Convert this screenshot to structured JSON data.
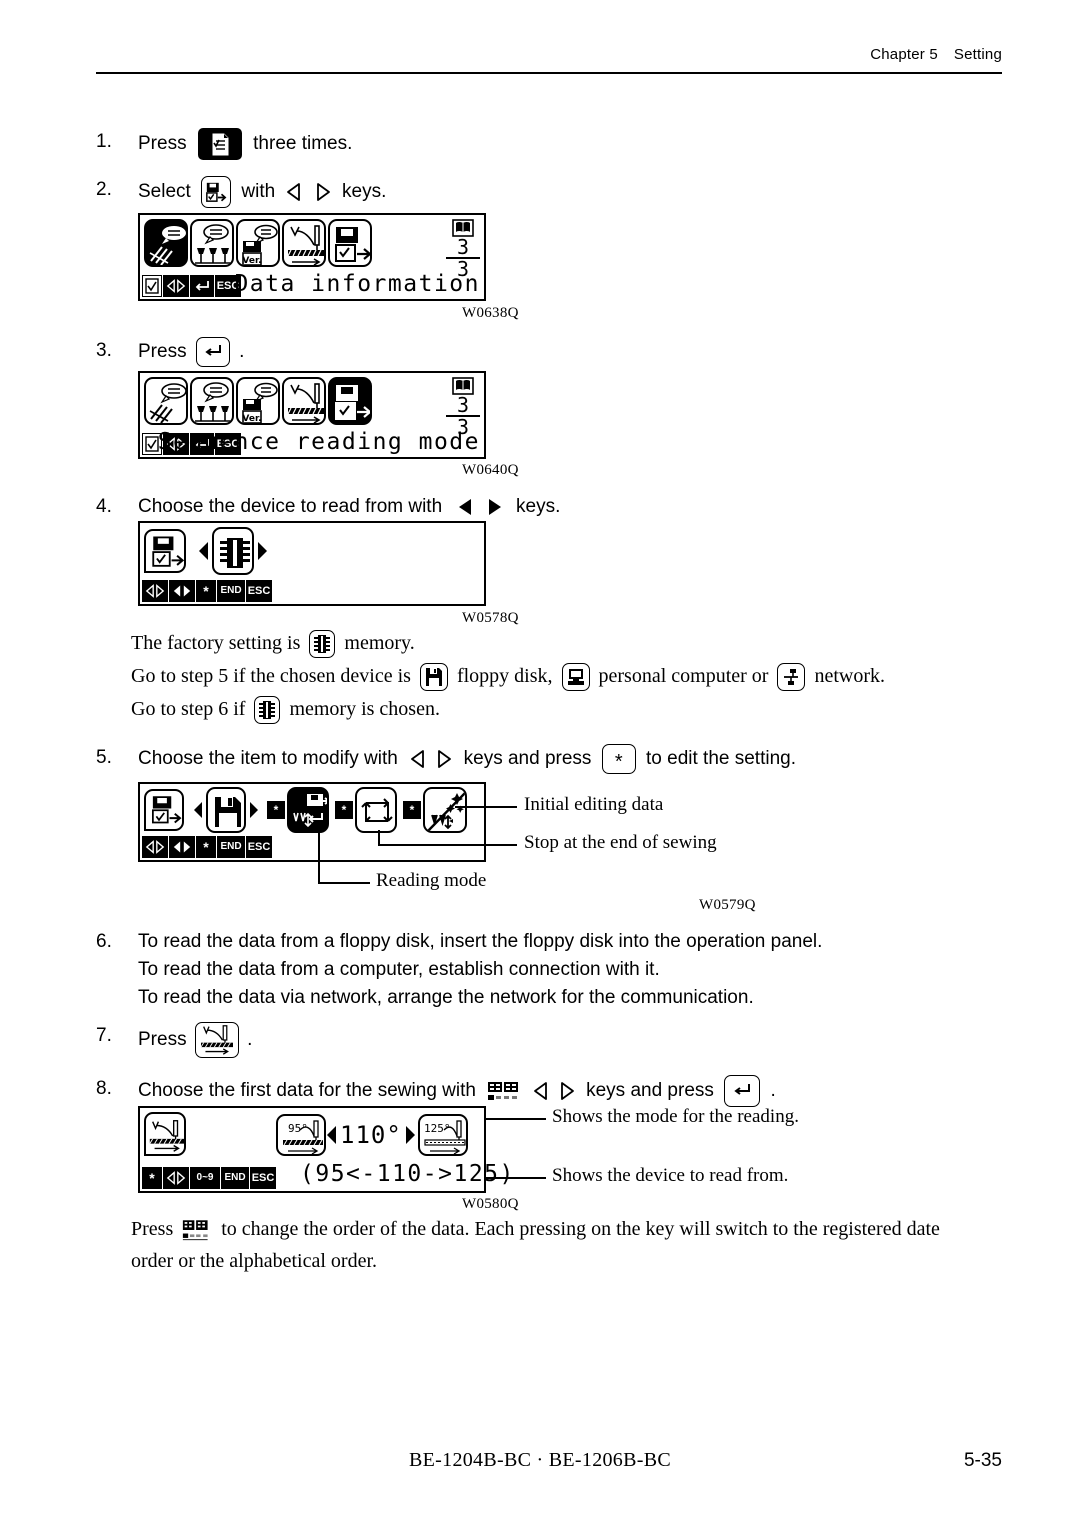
{
  "header": {
    "chapter": "Chapter 5",
    "section": "Setting"
  },
  "steps": [
    {
      "num": "1.",
      "lead": "Press",
      "tail": "three times.",
      "icon": "document-check-key"
    },
    {
      "num": "2.",
      "lead": "Select",
      "mid": "with",
      "tail": "keys.",
      "icon": "data-information-key"
    },
    {
      "num": "3.",
      "lead": "Press",
      "tail": ".",
      "icon": "enter-key"
    },
    {
      "num": "4.",
      "lead": "Choose the device to read from with",
      "tail": "keys."
    },
    {
      "num": "5.",
      "lead": "Choose the item to modify with",
      "mid": "keys and press",
      "tail": "to edit the setting.",
      "star": "*"
    },
    {
      "num": "6.",
      "lines": [
        "To read the data from a floppy disk, insert the floppy disk into the operation panel.",
        "To read the data from a computer, establish connection with it.",
        "To read the data via network, arrange the network for the communication."
      ]
    },
    {
      "num": "7.",
      "lead": "Press",
      "tail": "."
    },
    {
      "num": "8.",
      "lead": "Choose the first data for the sewing with",
      "mid": "keys and press",
      "tail": "."
    }
  ],
  "lcd1": {
    "message": "Data information",
    "page_current": "3",
    "page_total": "3",
    "selected_index": 0,
    "tiles": [
      "sewing-speech-icon",
      "tension-speech-icon",
      "version-speech-icon",
      "sewing-pattern-icon",
      "data-information-icon"
    ],
    "softkeys": [
      "check-icon",
      "left-right-arrows-icon",
      "enter-icon",
      "ESC"
    ],
    "caption": "W0638Q"
  },
  "lcd2": {
    "message": "Sequence reading mode",
    "page_current": "3",
    "page_total": "3",
    "selected_index": 4,
    "tiles": [
      "sewing-speech-icon",
      "tension-speech-icon",
      "version-speech-icon",
      "sewing-pattern-icon",
      "data-information-icon"
    ],
    "softkeys": [
      "check-icon",
      "left-right-arrows-icon",
      "enter-icon",
      "ESC"
    ],
    "caption": "W0640Q"
  },
  "lcd3": {
    "mode_icon": "data-information-icon",
    "device_icon": "memory-chip-icon",
    "softkeys": [
      "left-right-outline-icon",
      "left-right-solid-icon",
      "*",
      "END",
      "ESC"
    ],
    "caption": "W0578Q"
  },
  "lcd4": {
    "mode_icon": "data-information-icon",
    "device_icon": "floppy-disk-icon",
    "items": [
      "reading-mode-icon",
      "stop-at-end-of-sewing-icon",
      "initial-editing-data-icon"
    ],
    "selected_index": 0,
    "softkeys": [
      "left-right-outline-icon",
      "left-right-solid-icon",
      "*",
      "END",
      "ESC"
    ],
    "caption": "W0579Q",
    "callouts": [
      {
        "label": "Initial editing data"
      },
      {
        "label": "Stop at the end of sewing"
      },
      {
        "label": "Reading mode"
      }
    ]
  },
  "lcd5": {
    "mode_icon": "sewing-pattern-icon",
    "prev_value": "95°",
    "current_value": "110°",
    "next_value": "125°",
    "message": "(95<-110->125)",
    "softkeys": [
      "*",
      "left-right-outline-icon",
      "0~9",
      "END",
      "ESC"
    ],
    "caption": "W0580Q",
    "callouts": [
      {
        "label": "Shows the mode for the reading."
      },
      {
        "label": "Shows the device to read from."
      }
    ]
  },
  "factory_note": {
    "line1_pre": "The factory setting is",
    "line1_post": "memory.",
    "line2_pre": "Go to step 5 if the chosen device is",
    "line2_mid1": "floppy disk,",
    "line2_mid2": "personal computer or",
    "line2_post": "network.",
    "line3_pre": "Go to step 6 if",
    "line3_post": "memory is chosen."
  },
  "closing_note": {
    "pre": "Press",
    "line1_post": "to change the order of the data. Each pressing on the key will switch to the registered date",
    "line2": "order or the alphabetical order."
  },
  "footer": {
    "models": "BE-1204B-BC · BE-1206B-BC",
    "page": "5-35"
  }
}
